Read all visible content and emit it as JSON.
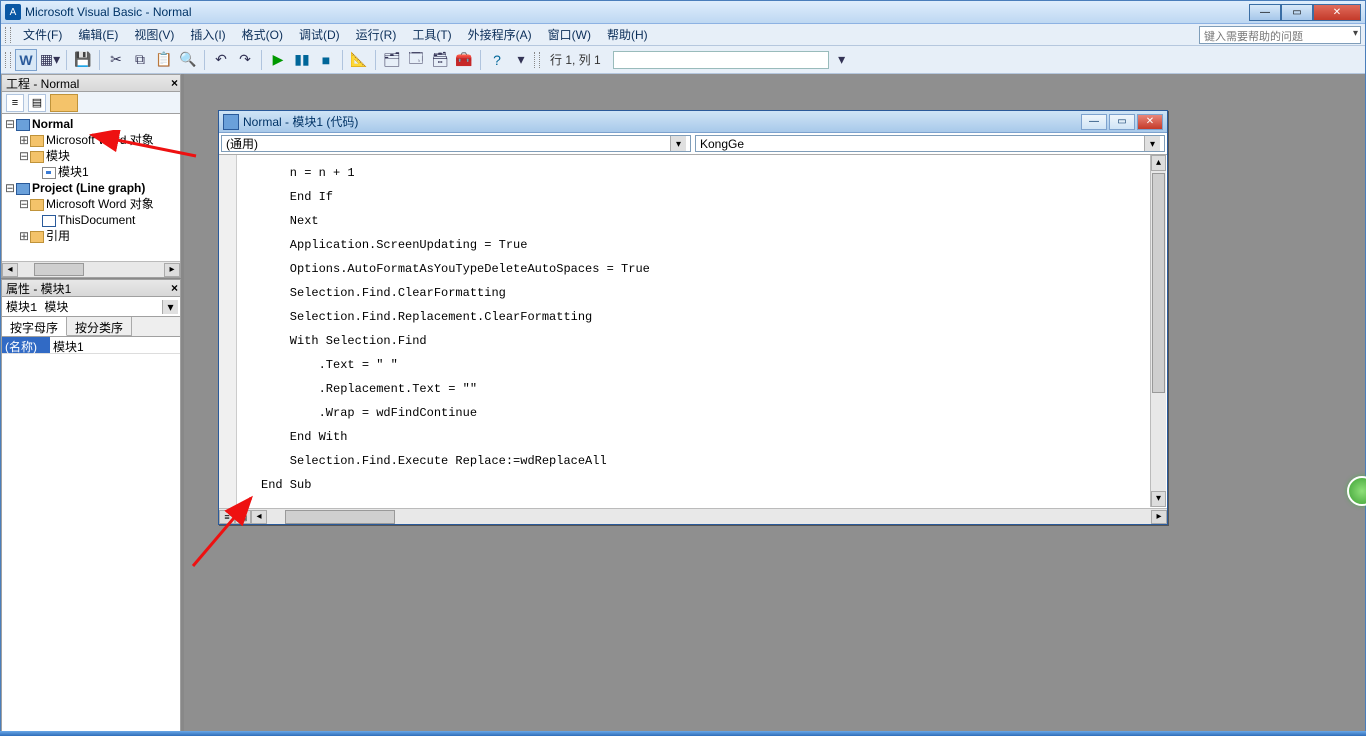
{
  "window": {
    "title": "Microsoft Visual Basic - Normal"
  },
  "menu": {
    "file": "文件(F)",
    "edit": "编辑(E)",
    "view": "视图(V)",
    "insert": "插入(I)",
    "format": "格式(O)",
    "debug": "调试(D)",
    "run": "运行(R)",
    "tools": "工具(T)",
    "addins": "外接程序(A)",
    "window": "窗口(W)",
    "help": "帮助(H)"
  },
  "help_placeholder": "键入需要帮助的问题",
  "status_position": "行 1, 列 1",
  "project_pane": {
    "title": "工程 - Normal",
    "tree": {
      "normal": "Normal",
      "word_objects": "Microsoft Word 对象",
      "modules": "模块",
      "module1": "模块1",
      "project_line": "Project (Line graph)",
      "word_objects2": "Microsoft Word 对象",
      "thisdoc": "ThisDocument",
      "refs": "引用"
    }
  },
  "properties_pane": {
    "title": "属性 - 模块1",
    "object_selector": "模块1 模块",
    "tab_alpha": "按字母序",
    "tab_cat": "按分类序",
    "row_name_key": "(名称)",
    "row_name_val": "模块1"
  },
  "code_window": {
    "title": "Normal - 模块1 (代码)",
    "combo_left": "(通用)",
    "combo_right": "KongGe",
    "code_text": "    n = n + 1\n    End If\n    Next\n    Application.ScreenUpdating = True\n    Options.AutoFormatAsYouTypeDeleteAutoSpaces = True\n    Selection.Find.ClearFormatting\n    Selection.Find.Replacement.ClearFormatting\n    With Selection.Find\n        .Text = \" \"\n        .Replacement.Text = \"\"\n        .Wrap = wdFindContinue\n    End With\n    Selection.Find.Execute Replace:=wdReplaceAll\nEnd Sub"
  }
}
